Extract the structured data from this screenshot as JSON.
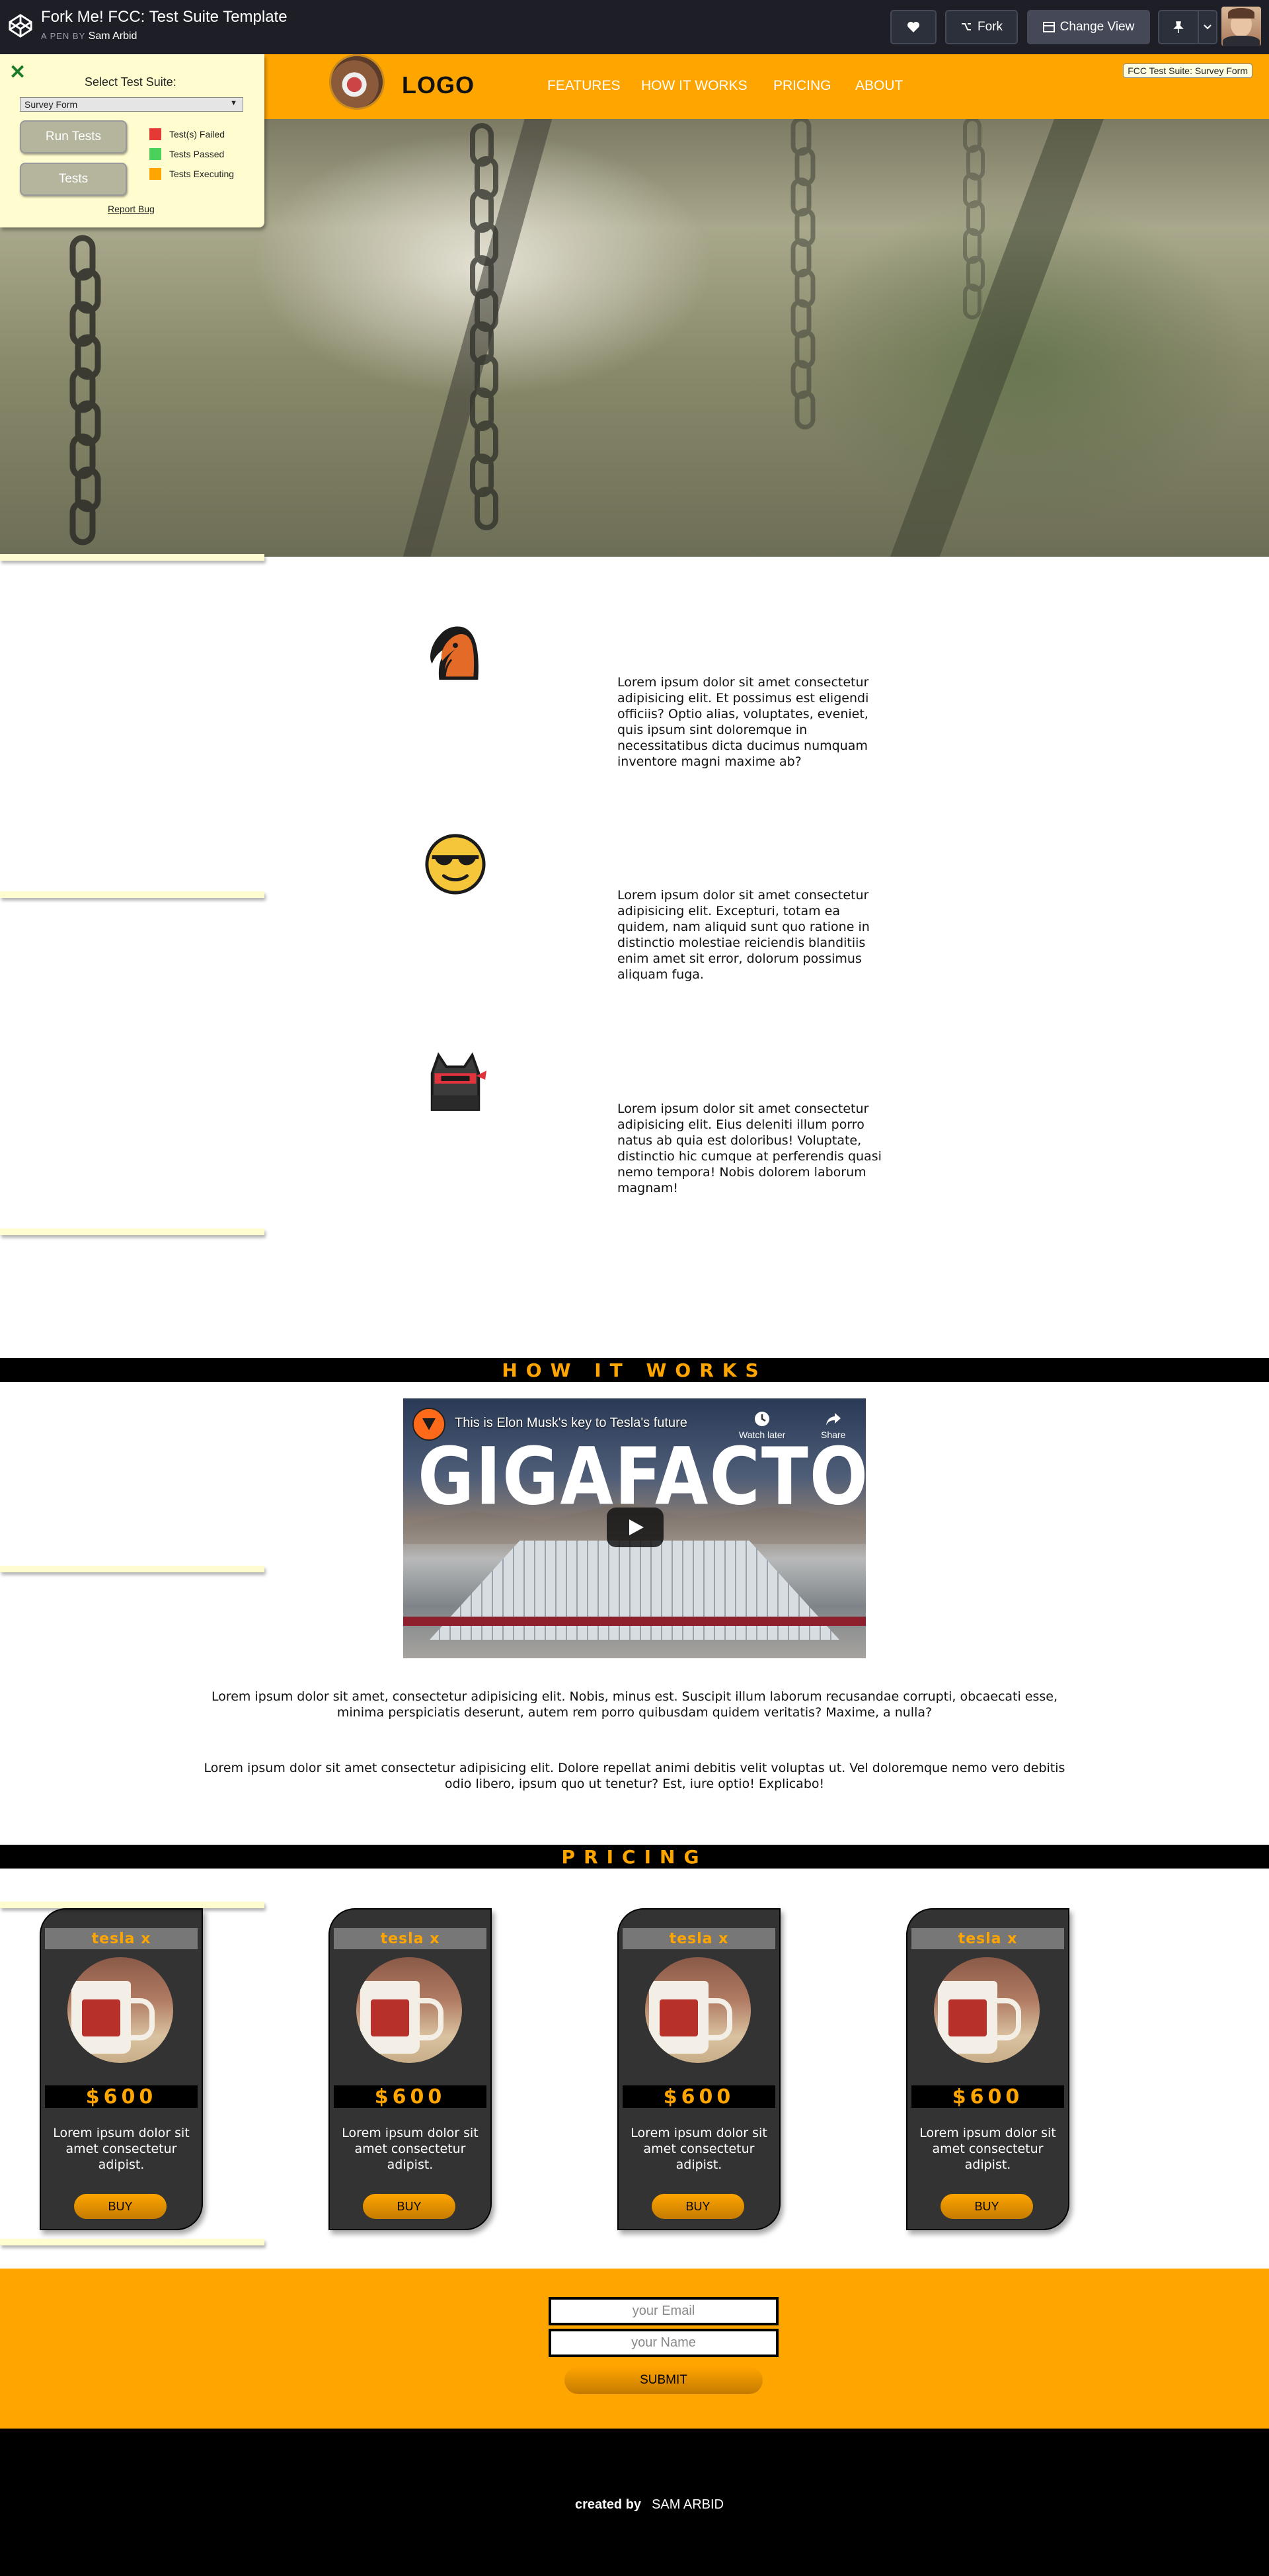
{
  "codepen": {
    "title": "Fork Me! FCC: Test Suite Template",
    "byline_prefix": "A PEN BY",
    "author": "Sam Arbid",
    "fork_label": "Fork",
    "change_view_label": "Change View"
  },
  "header": {
    "logo_text": "LOGO",
    "nav": [
      "FEATURES",
      "HOW IT WORKS",
      "PRICING",
      "ABOUT"
    ],
    "fcc_badge": "FCC Test Suite: Survey Form"
  },
  "test_panel": {
    "close_glyph": "✕",
    "select_label": "Select Test Suite:",
    "selected_suite": "Survey Form",
    "run_tests_label": "Run Tests",
    "tests_label": "Tests",
    "legend": [
      {
        "label": "Test(s) Failed",
        "color": "#e53935"
      },
      {
        "label": "Tests Passed",
        "color": "#4cd05c"
      },
      {
        "label": "Tests Executing",
        "color": "#ffa500"
      }
    ],
    "report_bug": "Report Bug"
  },
  "features": [
    {
      "icon": "knight-horse-icon",
      "text": "Lorem ipsum dolor sit amet consectetur adipisicing elit. Et possimus est eligendi officiis? Optio alias, voluptates, eveniet, quis ipsum sint doloremque in necessitatibus dicta ducimus numquam inventore magni maxime ab?"
    },
    {
      "icon": "sunglasses-smiley-icon",
      "text": "Lorem ipsum dolor sit amet consectetur adipisicing elit. Excepturi, totam ea quidem, nam aliquid sunt quo ratione in distinctio molestiae reiciendis blanditiis enim amet sit error, dolorum possimus aliquam fuga."
    },
    {
      "icon": "ninja-cat-icon",
      "text": "Lorem ipsum dolor sit amet consectetur adipisicing elit. Eius deleniti illum porro natus ab quia est doloribus! Voluptate, distinctio hic cumque at perferendis quasi nemo tempora! Nobis dolorem laborum magnam!"
    }
  ],
  "how_it_works": {
    "heading": "HOW IT WORKS",
    "video": {
      "title": "This is Elon Musk's key to Tesla's future",
      "overlay_text": "GIGAFACTORY",
      "watch_later": "Watch later",
      "share": "Share"
    },
    "paragraphs": [
      "Lorem ipsum dolor sit amet, consectetur adipisicing elit. Nobis, minus est. Suscipit illum laborum recusandae corrupti, obcaecati esse, minima perspiciatis deserunt, autem rem porro quibusdam quidem veritatis? Maxime, a nulla?",
      "Lorem ipsum dolor sit amet consectetur adipisicing elit. Dolore repellat animi debitis velit voluptas ut. Vel doloremque nemo vero debitis odio libero, ipsum quo ut tenetur? Est, iure optio! Explicabo!"
    ]
  },
  "pricing": {
    "heading": "PRICING",
    "cards": [
      {
        "name": "tesla x",
        "price": "$600",
        "desc": "Lorem ipsum dolor sit amet consectetur adipist.",
        "buy": "BUY"
      },
      {
        "name": "tesla x",
        "price": "$600",
        "desc": "Lorem ipsum dolor sit amet consectetur adipist.",
        "buy": "BUY"
      },
      {
        "name": "tesla x",
        "price": "$600",
        "desc": "Lorem ipsum dolor sit amet consectetur adipist.",
        "buy": "BUY"
      },
      {
        "name": "tesla x",
        "price": "$600",
        "desc": "Lorem ipsum dolor sit amet consectetur adipist.",
        "buy": "BUY"
      }
    ]
  },
  "contact": {
    "email_placeholder": "your Email",
    "name_placeholder": "your Name",
    "submit_label": "SUBMIT"
  },
  "footer": {
    "created_by": "created by",
    "author": "SAM ARBID"
  },
  "colors": {
    "accent": "#ffa500",
    "dark": "#000000",
    "card": "#333333"
  }
}
